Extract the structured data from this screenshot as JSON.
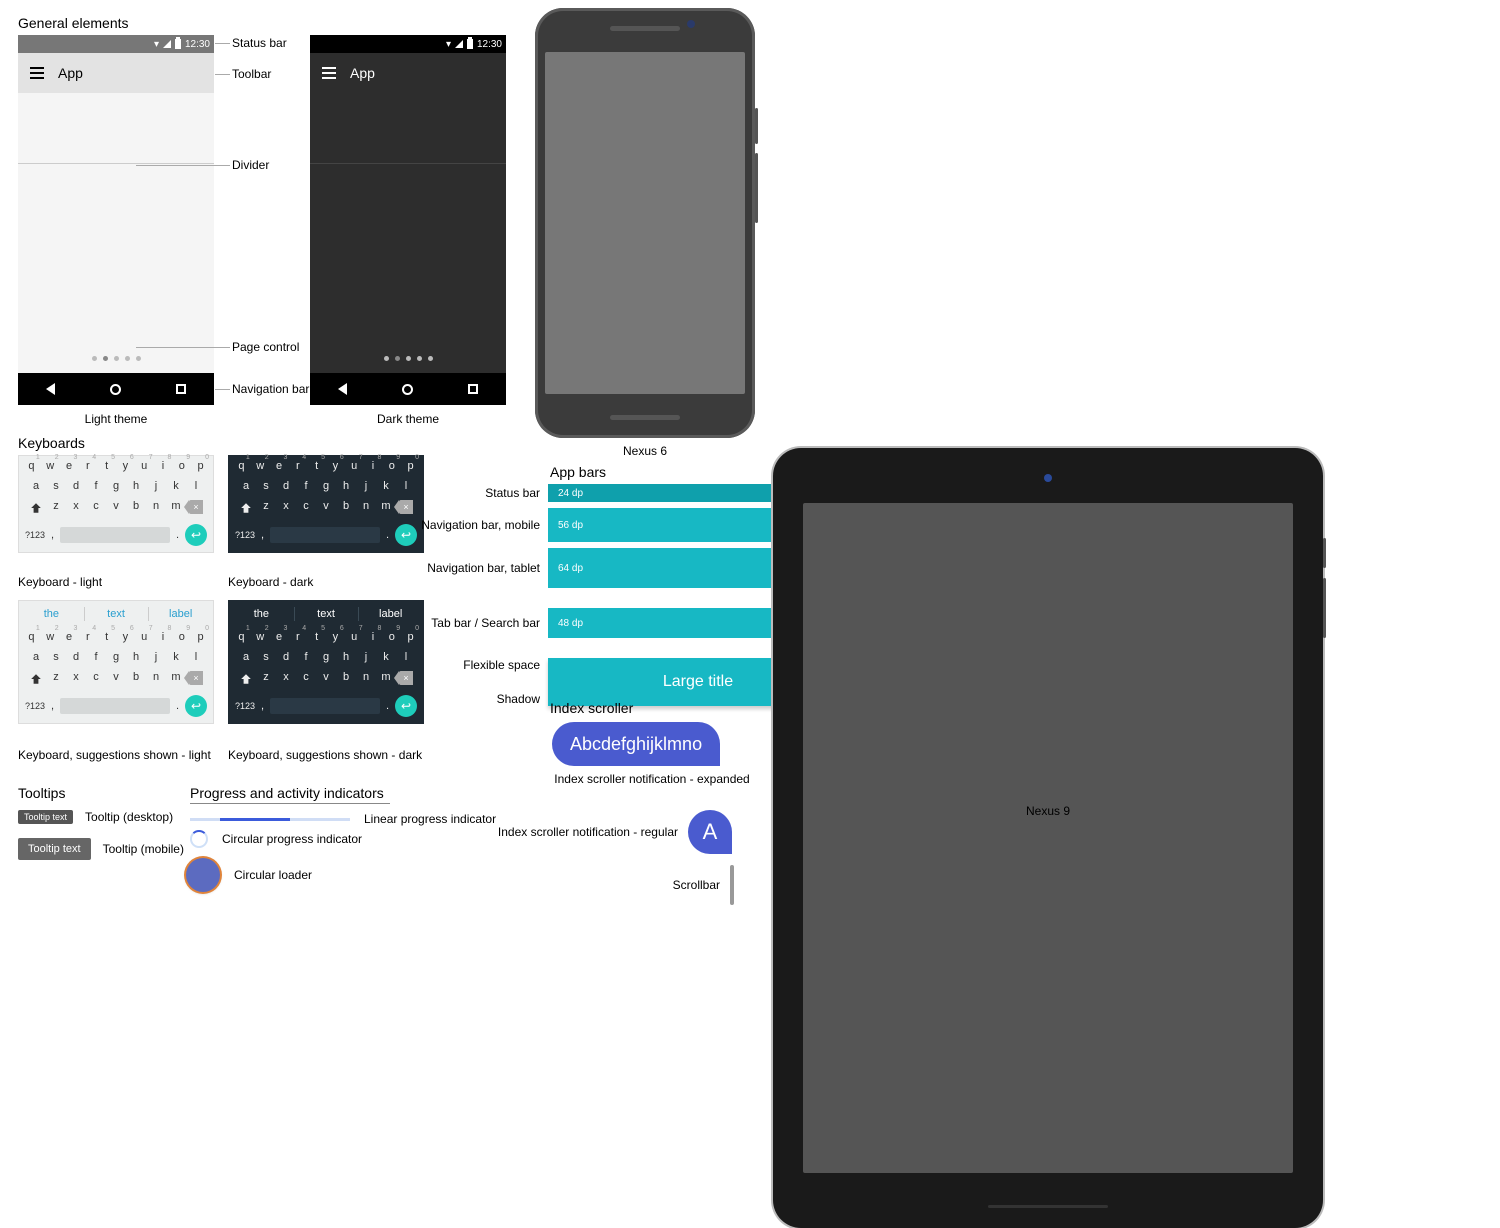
{
  "sections": {
    "general": "General elements",
    "keyboards": "Keyboards",
    "tooltips": "Tooltips",
    "progress": "Progress and activity indicators",
    "appbars": "App bars",
    "index": "Index scroller"
  },
  "annotations": {
    "status_bar": "Status bar",
    "toolbar": "Toolbar",
    "divider": "Divider",
    "page_control": "Page control",
    "navigation_bar": "Navigation bar"
  },
  "themes": {
    "light": "Light theme",
    "dark": "Dark theme",
    "app_title": "App",
    "time": "12:30"
  },
  "devices": {
    "nexus6": "Nexus 6",
    "nexus9": "Nexus 9"
  },
  "kbd": {
    "row1": [
      "q",
      "w",
      "e",
      "r",
      "t",
      "y",
      "u",
      "i",
      "o",
      "p"
    ],
    "row1n": [
      "1",
      "2",
      "3",
      "4",
      "5",
      "6",
      "7",
      "8",
      "9",
      "0"
    ],
    "row2": [
      "a",
      "s",
      "d",
      "f",
      "g",
      "h",
      "j",
      "k",
      "l"
    ],
    "row3": [
      "z",
      "x",
      "c",
      "v",
      "b",
      "n",
      "m"
    ],
    "q123": "?123",
    "suggestions": [
      "the",
      "text",
      "label"
    ],
    "cap_light": "Keyboard - light",
    "cap_dark": "Keyboard - dark",
    "cap_sugg_light": "Keyboard, suggestions shown - light",
    "cap_sugg_dark": "Keyboard, suggestions shown - dark"
  },
  "tooltips": {
    "desktop_sample": "Tooltip text",
    "desktop_label": "Tooltip (desktop)",
    "mobile_sample": "Tooltip text",
    "mobile_label": "Tooltip (mobile)"
  },
  "progress": {
    "linear": "Linear progress indicator",
    "circular": "Circular progress indicator",
    "loader": "Circular loader"
  },
  "appbars": {
    "status": {
      "label": "Status bar",
      "value": "24 dp"
    },
    "nav_mobile": {
      "label": "Navigation bar, mobile",
      "value": "56 dp"
    },
    "nav_tablet": {
      "label": "Navigation bar, tablet",
      "value": "64 dp"
    },
    "tab": {
      "label": "Tab bar / Search bar",
      "value": "48 dp"
    },
    "flex": {
      "label": "Flexible space",
      "title": "Large title"
    },
    "shadow": {
      "label": "Shadow"
    }
  },
  "index": {
    "expanded_text": "Abcdefghijklmno",
    "expanded_label": "Index scroller notification - expanded",
    "regular_text": "A",
    "regular_label": "Index scroller notification - regular",
    "scrollbar_label": "Scrollbar"
  }
}
